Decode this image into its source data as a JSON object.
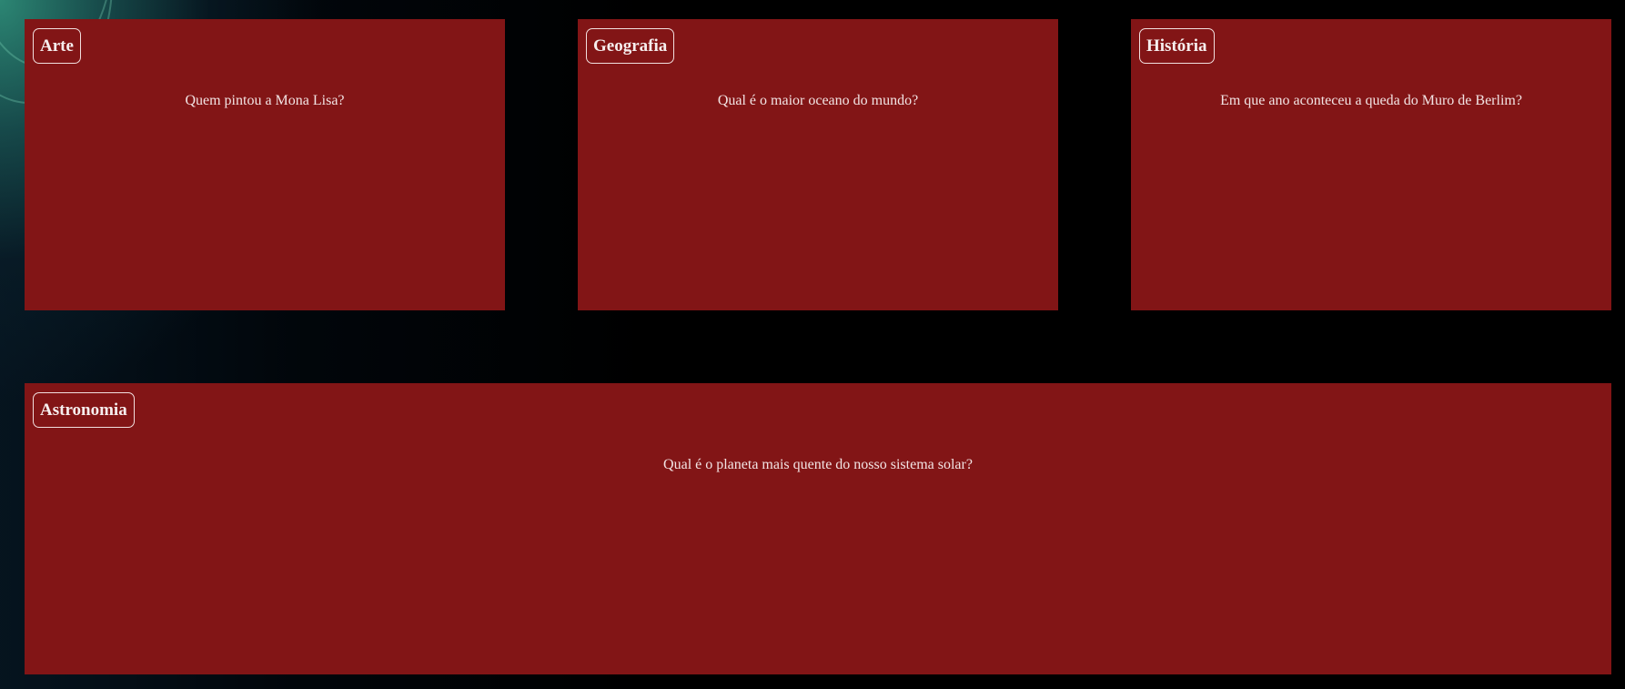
{
  "cards": [
    {
      "category": "Arte",
      "question": "Quem pintou a Mona Lisa?"
    },
    {
      "category": "Geografia",
      "question": "Qual é o maior oceano do mundo?"
    },
    {
      "category": "História",
      "question": "Em que ano aconteceu a queda do Muro de Berlim?"
    },
    {
      "category": "Astronomia",
      "question": "Qual é o planeta mais quente do nosso sistema solar?"
    }
  ],
  "colors": {
    "card_background": "#821516",
    "page_background": "#000000",
    "accent_glow": "#2e8c78"
  }
}
